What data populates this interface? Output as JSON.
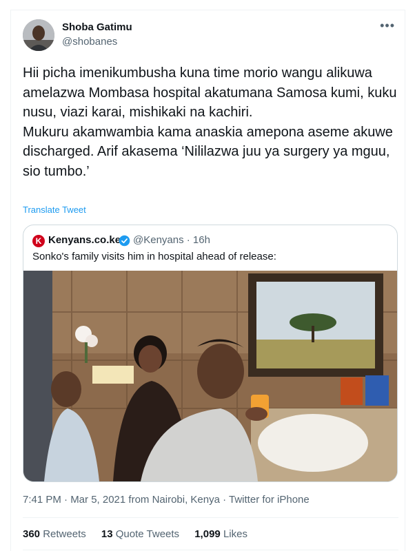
{
  "author": {
    "display_name": "Shoba Gatimu",
    "handle": "@shobanes"
  },
  "more_icon": "more-horizontal-icon",
  "tweet": {
    "paragraph1": "Hii picha imenikumbusha kuna time morio wangu alikuwa amelazwa Mombasa hospital akatumana Samosa kumi, kuku nusu, viazi karai, mishikaki na kachiri.",
    "paragraph2": "Mukuru akamwambia kama anaskia amepona aseme akuwe discharged. Arif akasema ‘Nililazwa juu ya surgery ya mguu, sio tumbo.’"
  },
  "translate_label": "Translate Tweet",
  "quoted": {
    "display_name": "Kenyans.co.ke",
    "logo_letter": "K",
    "handle_time": "@Kenyans · 16h",
    "text": "Sonko's family visits him in hospital ahead of release:"
  },
  "meta": "7:41 PM · Mar 5, 2021 from Nairobi, Kenya · Twitter for iPhone",
  "stats": {
    "retweets_count": "360",
    "retweets_label": "Retweets",
    "quotes_count": "13",
    "quotes_label": "Quote Tweets",
    "likes_count": "1,099",
    "likes_label": "Likes"
  },
  "colors": {
    "accent": "#1d9bf0",
    "brand_red": "#d0021b",
    "muted": "#536471"
  }
}
